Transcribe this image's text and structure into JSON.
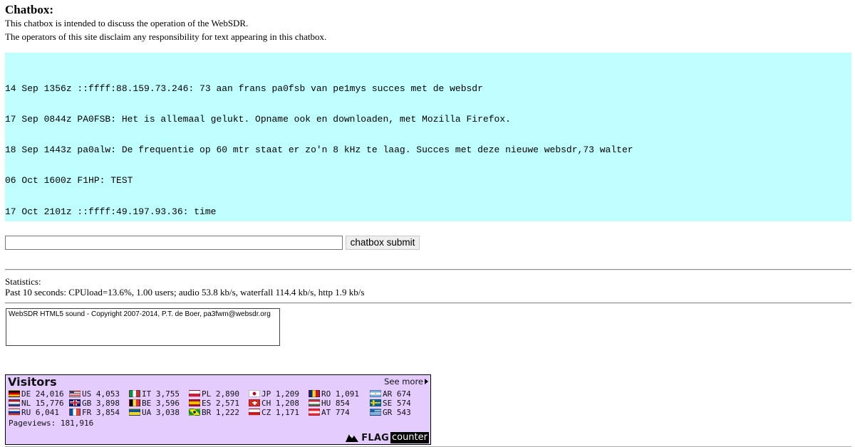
{
  "chatbox": {
    "heading": "Chatbox:",
    "intro": "This chatbox is intended to discuss the operation of the WebSDR.",
    "disclaimer": "The operators of this site disclaim any responsibility for text appearing in this chatbox.",
    "messages": [
      "14 Sep 1356z ::ffff:88.159.73.246: 73 aan frans pa0fsb van pe1mys succes met de websdr",
      "17 Sep 0844z PA0FSB: Het is allemaal gelukt. Opname ook en downloaden, met Mozilla Firefox.",
      "18 Sep 1443z pa0alw: De frequentie op 60 mtr staat er zo'n 8 kHz te laag. Succes met deze nieuwe websdr,73 walter",
      "06 Oct 1600z F1HP: TEST",
      "17 Oct 2101z ::ffff:49.197.93.36: time"
    ],
    "input_value": "",
    "submit_label": "chatbox submit",
    "bg_color": "#bfffff"
  },
  "statistics": {
    "heading": "Statistics:",
    "line": "Past 10 seconds: CPUload=13.6%, 1.00 users; audio 53.8 kb/s, waterfall 114.4 kb/s, http 1.9 kb/s"
  },
  "sound_box": {
    "text": "WebSDR HTML5 sound - Copyright 2007-2014, P.T. de Boer, pa3fwm@websdr.org"
  },
  "flag_counter": {
    "title": "Visitors",
    "see_more": "See more",
    "pageviews": "Pageviews: 181,916",
    "logo_flag": "FLAG",
    "logo_counter": "counter",
    "bg_color": "#e5ccff",
    "countries": [
      {
        "code": "DE",
        "count": "24,016",
        "flag": "de"
      },
      {
        "code": "NL",
        "count": "15,776",
        "flag": "nl"
      },
      {
        "code": "RU",
        "count": "6,041",
        "flag": "ru"
      },
      {
        "code": "US",
        "count": "4,053",
        "flag": "us"
      },
      {
        "code": "GB",
        "count": "3,898",
        "flag": "gb"
      },
      {
        "code": "FR",
        "count": "3,854",
        "flag": "fr"
      },
      {
        "code": "IT",
        "count": "3,755",
        "flag": "it"
      },
      {
        "code": "BE",
        "count": "3,596",
        "flag": "be"
      },
      {
        "code": "UA",
        "count": "3,038",
        "flag": "ua"
      },
      {
        "code": "PL",
        "count": "2,890",
        "flag": "pl"
      },
      {
        "code": "ES",
        "count": "2,571",
        "flag": "es"
      },
      {
        "code": "BR",
        "count": "1,222",
        "flag": "br"
      },
      {
        "code": "JP",
        "count": "1,209",
        "flag": "jp"
      },
      {
        "code": "CH",
        "count": "1,208",
        "flag": "ch"
      },
      {
        "code": "CZ",
        "count": "1,171",
        "flag": "cz"
      },
      {
        "code": "RO",
        "count": "1,091",
        "flag": "ro"
      },
      {
        "code": "HU",
        "count": "854",
        "flag": "hu"
      },
      {
        "code": "AT",
        "count": "774",
        "flag": "at"
      },
      {
        "code": "AR",
        "count": "674",
        "flag": "ar"
      },
      {
        "code": "SE",
        "count": "574",
        "flag": "se"
      },
      {
        "code": "GR",
        "count": "543",
        "flag": "gr"
      }
    ]
  }
}
